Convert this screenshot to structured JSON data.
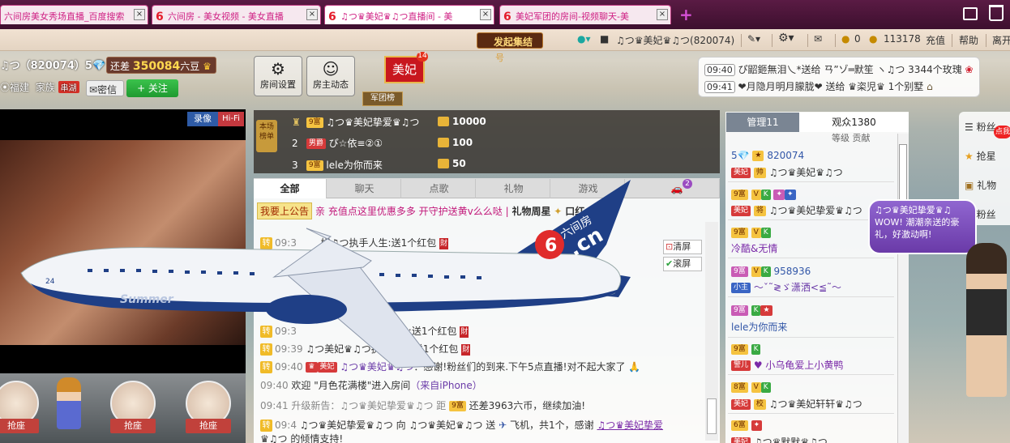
{
  "tabs": [
    {
      "label": "六间房美女秀场直播_百度搜索",
      "close": "×"
    },
    {
      "label": "六间房 - 美女视频 - 美女直播",
      "close": "×"
    },
    {
      "label": "♫つ♛美妃♛♫つ直播间 - 美",
      "close": "×"
    },
    {
      "label": "美妃军团的房间-视频聊天-美",
      "close": "×"
    }
  ],
  "new_tab": "+",
  "toolbar": {
    "rally_label": "发起集结",
    "rally_sub": "号",
    "user_name": "♫つ♛美妃♛♫つ(820074)",
    "coins": "0",
    "beans": "113178",
    "recharge": "充值",
    "help": "帮助",
    "leave": "离开"
  },
  "anchor": {
    "name_line": "♫つ（820074）5💎",
    "gap_prefix": "还差",
    "gap_value": "350084",
    "gap_suffix": "六豆",
    "location": "福建",
    "family_label": "家族",
    "family_tag": "串湖",
    "message_btn": "密信",
    "follow_btn": "+ 关注"
  },
  "room_buttons": {
    "settings": "房间设置",
    "anchor_activity": "房主动态"
  },
  "army": {
    "badge_name": "美妃",
    "badge_level": "14",
    "list_label": "军团榜"
  },
  "gift_feed": [
    {
      "time": "09:40",
      "text": "ぴ鼦鉔無泪乀*送给 ㄢ”ゾ═默笙 ヽ♫つ 3344个玫瑰"
    },
    {
      "time": "09:41",
      "text": "❤月隐月明月朦胧❤ 送给 ♛栥児♛ 1个别墅"
    }
  ],
  "video": {
    "rec_label": "录像",
    "hifi_label": "Hi-Fi",
    "seat_label": "抢座"
  },
  "leaderboard": {
    "tag": "本场榜单",
    "rows": [
      {
        "rank": "",
        "badge": "9富",
        "name": "♫つ♛美妃挚爱♛♫つ",
        "value": "10000"
      },
      {
        "rank": "2",
        "badge": "男爵",
        "name": "ぴ☆依≡②①",
        "value": "100"
      },
      {
        "rank": "3",
        "badge": "9富",
        "name": "lele为你而来",
        "value": "50"
      }
    ]
  },
  "chat": {
    "tabs": [
      "全部",
      "聊天",
      "点歌",
      "礼物",
      "游戏",
      ""
    ],
    "car_badge": "2",
    "notice_label": "我要上公告",
    "notice_text": "亲 充值点这里优惠多多 开守护送黄v么么哒",
    "notice_more": "礼物周星",
    "notice_tail": "口红",
    "clear_btn": "清屏",
    "scroll_btn": "滚屏",
    "lines": [
      {
        "time": "09:3",
        "text": "妃♫つ执手人生:送1个红包"
      },
      {
        "time": "09:3",
        "text": "手人生:送1个红包"
      },
      {
        "time": "09:39",
        "text": "♫つ美妃♛♫つ执手人生:送1个红包"
      },
      {
        "time": "09:40",
        "name": "♫つ♛美妃♛♫つ",
        "text": "：感谢!粉丝们的到来.下午5点直播!对不起大家了"
      },
      {
        "time": "09:40",
        "text": "欢迎 \"月色花满楼\"进入房间",
        "from": "（来自iPhone）"
      },
      {
        "time": "09:41",
        "text": "升级新告：♫つ♛美妃挚爱♛♫つ 距",
        "tail": "还差3963六币，继续加油!"
      },
      {
        "time": "09:4",
        "text": "♫つ♛美妃挚爱♛♫つ 向 ♫つ♛美妃♛♫つ 送",
        "gift": "飞机，共1个，感谢",
        "thanks": "♫つ♛美妃挚爱"
      },
      {
        "text": "♛♫つ 的倾情支持!"
      }
    ]
  },
  "audience": {
    "tab_admin": "管理11",
    "tab_viewers": "观众1380",
    "rank_header": "等级 贡献",
    "rows": [
      {
        "badge": "5💎",
        "name": "820074"
      },
      {
        "badge": "美妃",
        "name": "♫つ♛美妃♛♫つ"
      },
      {
        "badge": "9富",
        "name": "♫つ♛美妃挚爱♛♫つ"
      },
      {
        "badge": "9富",
        "name": "冷酷&无情"
      },
      {
        "badge": "9富",
        "name": "958936"
      },
      {
        "badge": "小主",
        "name": "〜ˇ˜≷ゞ潇洒<≦˜〜"
      },
      {
        "badge": "9富",
        "name": "lele为你而来"
      },
      {
        "badge": "9富",
        "name": "♥ 小乌龟爱上小黄鸭"
      },
      {
        "badge": "美妃",
        "name": "♫つ♛美妃轩轩♛♫つ"
      },
      {
        "badge": "6富",
        "name": "♫つ♛默默♛♫つ"
      }
    ]
  },
  "right_panel": {
    "items": [
      "粉丝",
      "抢星",
      "礼物",
      "粉丝"
    ],
    "hot": "点我",
    "speech": "♫つ♛美妃挚爱♛♫ WOW! 潮潮亲送的豪礼，好激动啊!"
  },
  "plane": {
    "brand": "六间房",
    "domain": ".cn",
    "name": "Summer",
    "number": "24"
  },
  "colors": {
    "tabbar": "#4a1438",
    "tab_text": "#cf1f83",
    "accent_green": "#2bb03c",
    "badge_gold": "#f5c340",
    "plane_blue": "#1f3f86"
  }
}
